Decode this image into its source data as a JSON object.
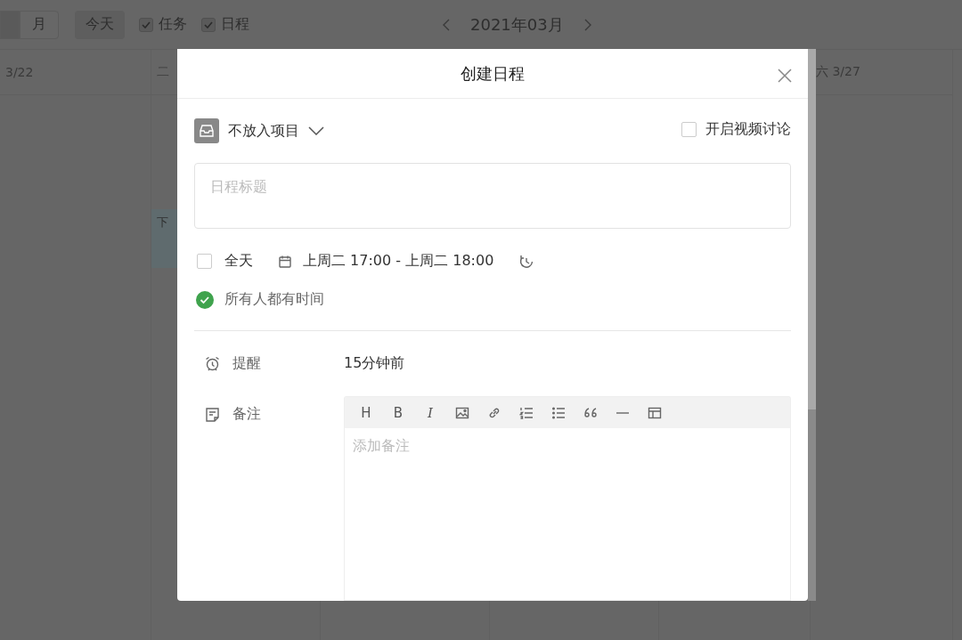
{
  "toolbar": {
    "view_buttons": [
      {
        "selected": true
      },
      {
        "label": "月",
        "selected": false
      }
    ],
    "today_button": "今天",
    "filters": [
      {
        "label": "任务",
        "checked": true
      },
      {
        "label": "日程",
        "checked": true
      }
    ],
    "month": "2021年03月"
  },
  "calendar": {
    "day_headers": [
      {
        "label": "3/22"
      },
      {
        "label": "二"
      },
      {
        "label": "六 3/27"
      }
    ],
    "event": "下"
  },
  "dialog": {
    "title": "创建日程",
    "project": "不放入项目",
    "video_discussion": {
      "label": "开启视频讨论",
      "checked": false
    },
    "title_field": {
      "placeholder": "日程标题"
    },
    "all_day": {
      "label": "全天",
      "checked": false
    },
    "time_range": "上周二 17:00 - 上周二 18:00",
    "availability": "所有人都有时间",
    "reminder": {
      "label": "提醒",
      "value": "15分钟前"
    },
    "notes": {
      "label": "备注",
      "placeholder": "添加备注",
      "toolbar": [
        {
          "kind": "text",
          "label": "H"
        },
        {
          "kind": "text",
          "label": "B"
        },
        {
          "kind": "italic",
          "label": "I"
        },
        {
          "kind": "image"
        },
        {
          "kind": "link"
        },
        {
          "kind": "ordered-list"
        },
        {
          "kind": "bullet-list"
        },
        {
          "kind": "quote"
        },
        {
          "kind": "rule"
        },
        {
          "kind": "table"
        }
      ]
    }
  }
}
